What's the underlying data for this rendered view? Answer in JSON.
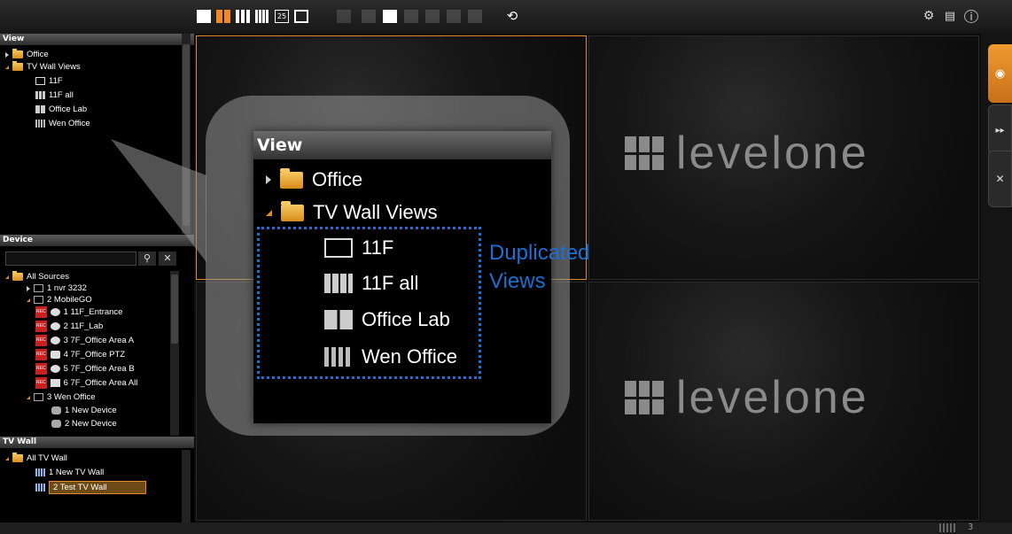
{
  "toolbar": {
    "icons": [
      "layout-1-icon",
      "layout-4-icon",
      "layout-9-icon",
      "layout-16-icon",
      "layout-25-icon",
      "layout-pip-icon",
      "view-icon",
      "edit-view-icon",
      "add-view-icon",
      "delete-view-icon",
      "copy-view-icon",
      "save-view-icon",
      "sync-icon",
      "settings-icon",
      "document-icon",
      "info-icon"
    ],
    "layout_25_label": "25"
  },
  "view_panel": {
    "title": "View",
    "items": [
      {
        "label": "Office",
        "icon": "folder-icon"
      },
      {
        "label": "TV Wall Views",
        "icon": "folder-icon"
      },
      {
        "label": "11F",
        "icon": "single-view-icon"
      },
      {
        "label": "11F all",
        "icon": "grid-view-icon"
      },
      {
        "label": "Office Lab",
        "icon": "quad-view-icon"
      },
      {
        "label": "Wen Office",
        "icon": "sixteen-view-icon"
      }
    ]
  },
  "device_panel": {
    "title": "Device",
    "search_value": "",
    "items": [
      {
        "label": "All Sources"
      },
      {
        "label": "1 nvr 3232"
      },
      {
        "label": "2 MobileGO"
      },
      {
        "label": "1 11F_Entrance"
      },
      {
        "label": "2 11F_Lab"
      },
      {
        "label": "3 7F_Office Area A"
      },
      {
        "label": "4 7F_Office PTZ"
      },
      {
        "label": "5 7F_Office Area B"
      },
      {
        "label": "6 7F_Office Area All"
      },
      {
        "label": "3 Wen Office"
      },
      {
        "label": "1 New Device"
      },
      {
        "label": "2 New Device"
      }
    ],
    "rec_badge": "REC"
  },
  "tvwall_panel": {
    "title": "TV Wall",
    "items": [
      {
        "label": "All TV Wall"
      },
      {
        "label": "1 New TV Wall"
      },
      {
        "label": "2 Test TV Wall"
      }
    ]
  },
  "main": {
    "brand": "levelone"
  },
  "callout": {
    "title": "View",
    "items": [
      {
        "label": "Office"
      },
      {
        "label": "TV Wall Views"
      },
      {
        "label": "11F"
      },
      {
        "label": "11F all"
      },
      {
        "label": "Office Lab"
      },
      {
        "label": "Wen Office"
      }
    ],
    "annotation_line1": "Duplicated",
    "annotation_line2": "Views",
    "annotation_color": "#1d6fd1"
  },
  "status": {
    "count": "3"
  },
  "colors": {
    "accent": "#e08a2c",
    "selected_bg": "#6e4a17"
  }
}
